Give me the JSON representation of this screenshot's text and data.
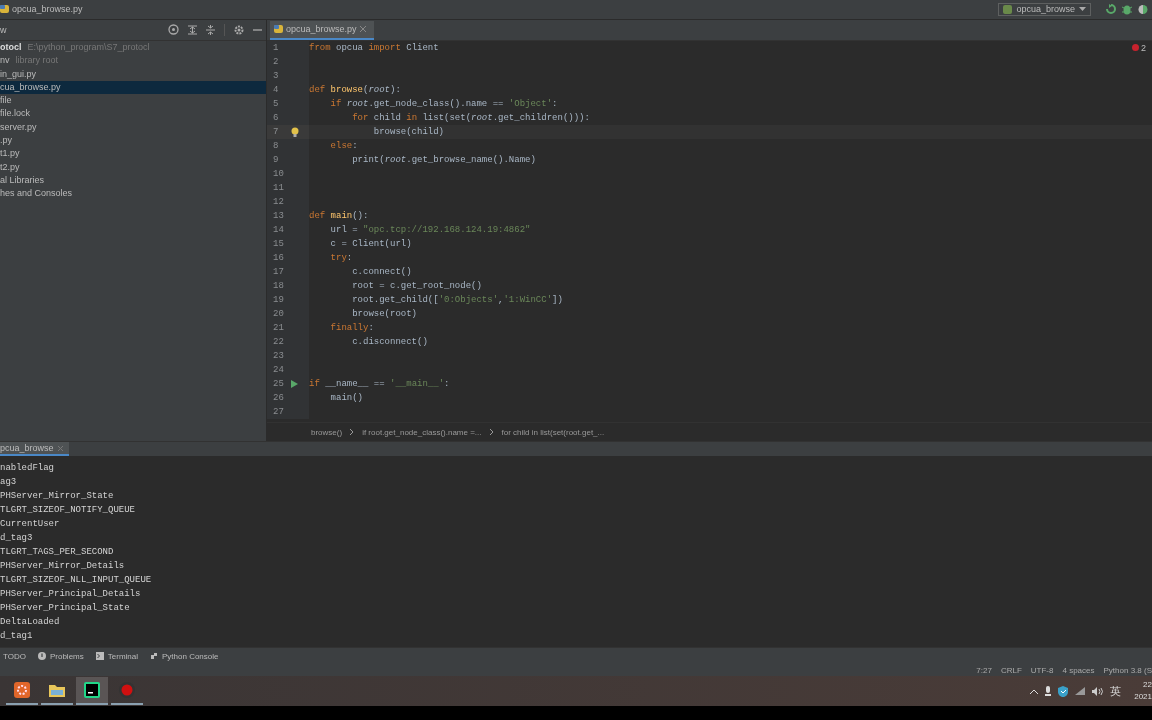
{
  "title_bar": {
    "file": "opcua_browse.py",
    "run_config": "opcua_browse"
  },
  "project": {
    "header": "w",
    "root": {
      "text": "otocl",
      "path": "E:\\python_program\\S7_protocl"
    },
    "items": [
      {
        "text": "nv",
        "note": "library root",
        "selected": false
      },
      {
        "text": "in_gui.py",
        "selected": false
      },
      {
        "text": "cua_browse.py",
        "selected": true
      },
      {
        "text": "file",
        "selected": false
      },
      {
        "text": "file.lock",
        "selected": false
      },
      {
        "text": "server.py",
        "selected": false
      },
      {
        "text": ".py",
        "selected": false
      },
      {
        "text": "t1.py",
        "selected": false
      },
      {
        "text": "t2.py",
        "selected": false
      },
      {
        "text": "al Libraries",
        "selected": false
      },
      {
        "text": "hes and Consoles",
        "selected": false
      }
    ]
  },
  "editor": {
    "tab": "opcua_browse.py",
    "error_count": "2",
    "lines": [
      {
        "number": "1",
        "current": false,
        "hint": false,
        "runnable": false,
        "tokens": [
          {
            "text": "from",
            "kind": "kw"
          },
          {
            "text": " opcua ",
            "kind": "plain"
          },
          {
            "text": "import",
            "kind": "kw"
          },
          {
            "text": " Client",
            "kind": "plain"
          }
        ]
      },
      {
        "number": "2",
        "current": false,
        "hint": false,
        "runnable": false
      },
      {
        "number": "3",
        "current": false,
        "hint": false,
        "runnable": false
      },
      {
        "number": "4",
        "current": false,
        "hint": false,
        "runnable": false,
        "tokens": [
          {
            "text": "def",
            "kind": "kw"
          },
          {
            "text": " browse",
            "kind": "def"
          },
          {
            "text": "(",
            "kind": "plain"
          },
          {
            "text": "root",
            "kind": "param"
          },
          {
            "text": "):",
            "kind": "plain"
          }
        ]
      },
      {
        "number": "5",
        "current": false,
        "hint": false,
        "runnable": false,
        "tokens": [
          {
            "text": "    if",
            "kind": "kw"
          },
          {
            "text": " root",
            "kind": "param"
          },
          {
            "text": ".get_node_class().name == ",
            "kind": "plain"
          },
          {
            "text": "'Object'",
            "kind": "str"
          },
          {
            "text": ":",
            "kind": "plain"
          }
        ]
      },
      {
        "number": "6",
        "current": false,
        "hint": false,
        "runnable": false,
        "tokens": [
          {
            "text": "        for",
            "kind": "kw"
          },
          {
            "text": " child ",
            "kind": "plain"
          },
          {
            "text": "in",
            "kind": "kw"
          },
          {
            "text": " list(set(",
            "kind": "plain"
          },
          {
            "text": "root",
            "kind": "param"
          },
          {
            "text": ".get_children())):",
            "kind": "plain"
          }
        ]
      },
      {
        "number": "7",
        "current": true,
        "hint": true,
        "runnable": false,
        "tokens": [
          {
            "text": "            browse(child)",
            "kind": "plain"
          }
        ]
      },
      {
        "number": "8",
        "current": false,
        "hint": false,
        "runnable": false,
        "tokens": [
          {
            "text": "    else",
            "kind": "kw"
          },
          {
            "text": ":",
            "kind": "plain"
          }
        ]
      },
      {
        "number": "9",
        "current": false,
        "hint": false,
        "runnable": false,
        "tokens": [
          {
            "text": "        print(",
            "kind": "plain"
          },
          {
            "text": "root",
            "kind": "param"
          },
          {
            "text": ".get_browse_name().Name)",
            "kind": "plain"
          }
        ]
      },
      {
        "number": "10",
        "current": false,
        "hint": false,
        "runnable": false
      },
      {
        "number": "11",
        "current": false,
        "hint": false,
        "runnable": false
      },
      {
        "number": "12",
        "current": false,
        "hint": false,
        "runnable": false
      },
      {
        "number": "13",
        "current": false,
        "hint": false,
        "runnable": false,
        "tokens": [
          {
            "text": "def",
            "kind": "kw"
          },
          {
            "text": " main",
            "kind": "def"
          },
          {
            "text": "():",
            "kind": "plain"
          }
        ]
      },
      {
        "number": "14",
        "current": false,
        "hint": false,
        "runnable": false,
        "tokens": [
          {
            "text": "    url = ",
            "kind": "plain"
          },
          {
            "text": "\"opc.tcp://192.168.124.19:4862\"",
            "kind": "str"
          }
        ]
      },
      {
        "number": "15",
        "current": false,
        "hint": false,
        "runnable": false,
        "tokens": [
          {
            "text": "    c = Client(url)",
            "kind": "plain"
          }
        ]
      },
      {
        "number": "16",
        "current": false,
        "hint": false,
        "runnable": false,
        "tokens": [
          {
            "text": "    try",
            "kind": "kw"
          },
          {
            "text": ":",
            "kind": "plain"
          }
        ]
      },
      {
        "number": "17",
        "current": false,
        "hint": false,
        "runnable": false,
        "tokens": [
          {
            "text": "        c.connect()",
            "kind": "plain"
          }
        ]
      },
      {
        "number": "18",
        "current": false,
        "hint": false,
        "runnable": false,
        "tokens": [
          {
            "text": "        root = c.get_root_node()",
            "kind": "plain"
          }
        ]
      },
      {
        "number": "19",
        "current": false,
        "hint": false,
        "runnable": false,
        "tokens": [
          {
            "text": "        root.get_child([",
            "kind": "plain"
          },
          {
            "text": "'0:Objects'",
            "kind": "str"
          },
          {
            "text": ",",
            "kind": "plain"
          },
          {
            "text": "'1:WinCC'",
            "kind": "str"
          },
          {
            "text": "])",
            "kind": "plain"
          }
        ]
      },
      {
        "number": "20",
        "current": false,
        "hint": false,
        "runnable": false,
        "tokens": [
          {
            "text": "        browse(root)",
            "kind": "plain"
          }
        ]
      },
      {
        "number": "21",
        "current": false,
        "hint": false,
        "runnable": false,
        "tokens": [
          {
            "text": "    finally",
            "kind": "kw"
          },
          {
            "text": ":",
            "kind": "plain"
          }
        ]
      },
      {
        "number": "22",
        "current": false,
        "hint": false,
        "runnable": false,
        "tokens": [
          {
            "text": "        c.disconnect()",
            "kind": "plain"
          }
        ]
      },
      {
        "number": "23",
        "current": false,
        "hint": false,
        "runnable": false
      },
      {
        "number": "24",
        "current": false,
        "hint": false,
        "runnable": false
      },
      {
        "number": "25",
        "current": false,
        "hint": false,
        "runnable": true,
        "tokens": [
          {
            "text": "if",
            "kind": "kw"
          },
          {
            "text": " __name__ == ",
            "kind": "plain"
          },
          {
            "text": "'__main__'",
            "kind": "str"
          },
          {
            "text": ":",
            "kind": "plain"
          }
        ]
      },
      {
        "number": "26",
        "current": false,
        "hint": false,
        "runnable": false,
        "tokens": [
          {
            "text": "    main()",
            "kind": "plain"
          }
        ]
      },
      {
        "number": "27",
        "current": false,
        "hint": false,
        "runnable": false
      }
    ],
    "breadcrumbs": [
      "browse()",
      "if root.get_node_class().name =...",
      "for child in list(set(root.get_..."
    ]
  },
  "run": {
    "tab": "pcua_browse",
    "output": [
      "nabledFlag",
      "ag3",
      "PHServer_Mirror_State",
      "TLGRT_SIZEOF_NOTIFY_QUEUE",
      "CurrentUser",
      "d_tag3",
      "TLGRT_TAGS_PER_SECOND",
      "PHServer_Mirror_Details",
      "TLGRT_SIZEOF_NLL_INPUT_QUEUE",
      "PHServer_Principal_Details",
      "PHServer_Principal_State",
      "DeltaLoaded",
      "d_tag1"
    ]
  },
  "tool_windows": [
    "TODO",
    "Problems",
    "Terminal",
    "Python Console"
  ],
  "status_bar": [
    "7:27",
    "CRLF",
    "UTF-8",
    "4 spaces",
    "Python 3.8 (S"
  ],
  "taskbar": {
    "apps": [
      {
        "selected": false
      },
      {
        "selected": false
      },
      {
        "selected": true
      },
      {
        "selected": false
      }
    ],
    "input_method": "英",
    "clock": [
      "22",
      "2021"
    ]
  }
}
